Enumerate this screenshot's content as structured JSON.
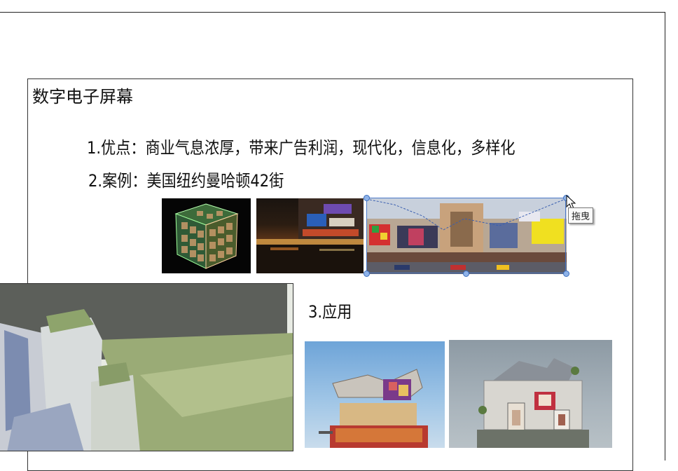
{
  "slide": {
    "title": "数字电子屏幕",
    "point1": "1.优点：商业气息浓厚，带来广告利润，现代化，信息化，多样化",
    "point2": "2.案例：美国纽约曼哈顿42街",
    "point3": "3.应用"
  },
  "tooltip": {
    "drag_label": "拖曳"
  },
  "images": {
    "cube_screen": "led-cube-photo",
    "street_night": "times-square-night-photo",
    "times_square_collage": "42nd-street-billboards-photo",
    "building_render": "aerial-3d-building-render",
    "application_1": "media-facade-building-render",
    "application_2": "billboard-cube-building-render"
  },
  "colors": {
    "selection": "#4a78c8",
    "handle": "#8fb3e8"
  }
}
